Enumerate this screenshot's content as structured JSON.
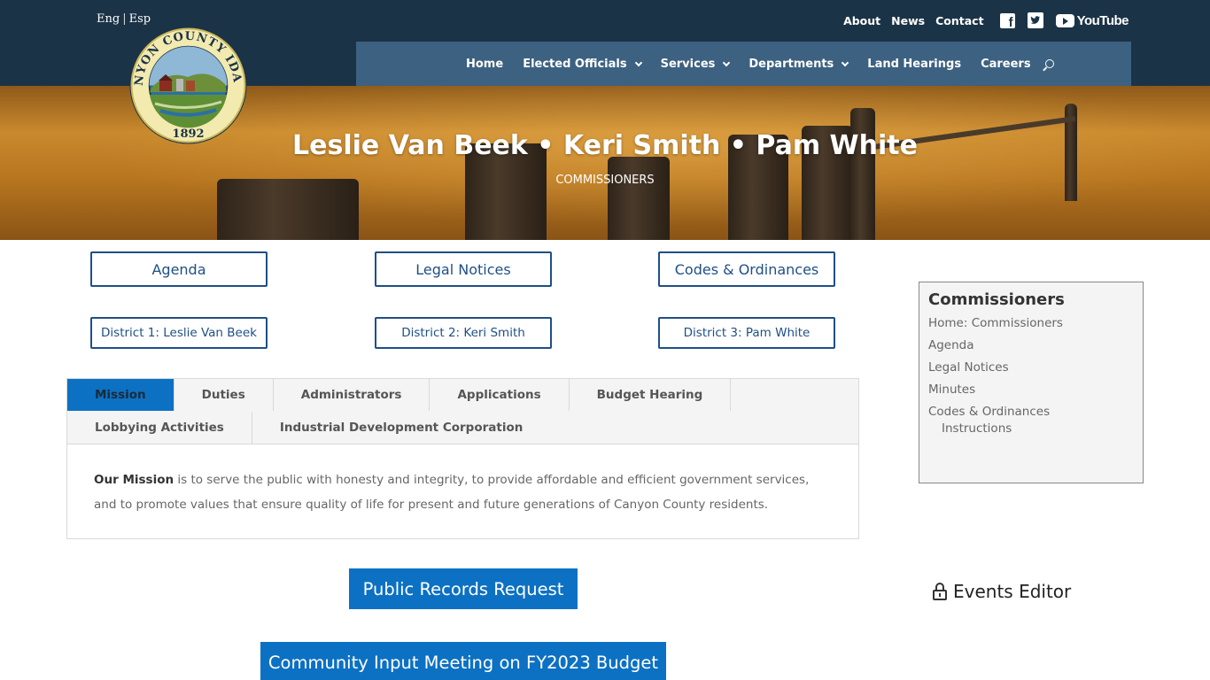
{
  "header": {
    "lang_en": "Eng",
    "lang_sep": "|",
    "lang_es": "Esp",
    "seal_top_text": "CANYON COUNTY IDAHO",
    "seal_year": "1892",
    "secondary_links": [
      "About",
      "News",
      "Contact"
    ],
    "youtube_label": "YouTube",
    "nav": [
      {
        "label": "Home",
        "dropdown": false
      },
      {
        "label": "Elected Officials",
        "dropdown": true
      },
      {
        "label": "Services",
        "dropdown": true
      },
      {
        "label": "Departments",
        "dropdown": true
      },
      {
        "label": "Land Hearings",
        "dropdown": false
      },
      {
        "label": "Careers",
        "dropdown": false
      }
    ],
    "colors": {
      "topbar": "#1b3347",
      "nav": "#3d6180",
      "accent": "#0c71c3",
      "outline": "#1f4f86"
    }
  },
  "hero": {
    "title": "Leslie Van Beek • Keri Smith • Pam White",
    "subtitle": "COMMISSIONERS"
  },
  "quick_links": {
    "agenda": "Agenda",
    "legal_notices": "Legal Notices",
    "codes": "Codes & Ordinances",
    "district1": "District 1: Leslie Van Beek",
    "district2": "District 2: Keri Smith",
    "district3": "District 3: Pam White"
  },
  "tabs": {
    "labels": [
      "Mission",
      "Duties",
      "Administrators",
      "Applications",
      "Budget Hearing",
      "Lobbying Activities",
      "Industrial Development Corporation"
    ],
    "active": "Mission",
    "content_bold": "Our Mission",
    "content_text": " is to serve the public with honesty and integrity, to provide affordable and efficient government services, and to promote values that ensure quality of life for present and future generations of Canyon County residents."
  },
  "cta": {
    "public_records": "Public Records Request",
    "community_meeting": "Community Input Meeting on FY2023 Budget"
  },
  "sidebar": {
    "title": "Commissioners",
    "links": [
      "Home: Commissioners",
      "Agenda",
      "Legal Notices",
      "Minutes",
      "Codes & Ordinances"
    ],
    "sub_link": "Instructions"
  },
  "events_editor": "Events Editor"
}
